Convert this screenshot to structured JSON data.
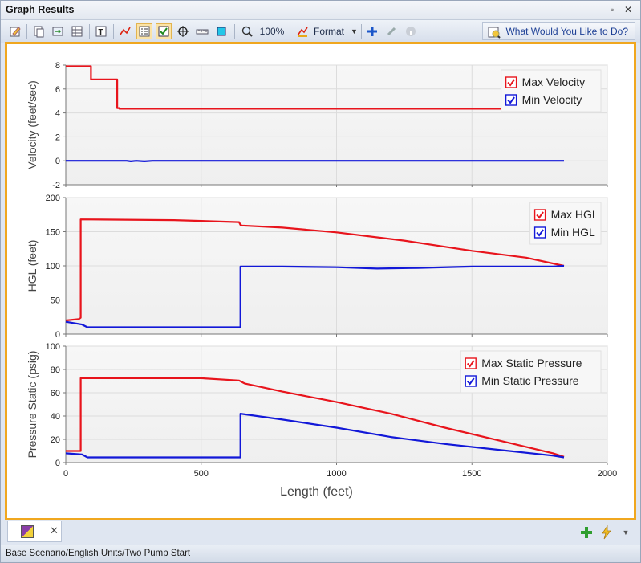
{
  "window": {
    "title": "Graph Results",
    "pin_glyph": "▫",
    "close_glyph": "✕"
  },
  "toolbar": {
    "zoom_label": "100%",
    "format_label": "Format",
    "what_label": "What Would You Like to Do?",
    "icons": [
      "edit-icon",
      "copy-icon",
      "export-icon",
      "table-icon",
      "text-icon",
      "line-style-icon",
      "legend-icon",
      "checkbox-icon",
      "crosshair-icon",
      "ruler-icon",
      "box-icon",
      "zoom-icon",
      "format-icon",
      "add-icon",
      "pin-icon",
      "info-icon",
      "help-icon"
    ]
  },
  "tab": {
    "close_glyph": "✕"
  },
  "status": {
    "text": "Base Scenario/English Units/Two Pump Start"
  },
  "colors": {
    "max_series": "#e8141c",
    "min_series": "#1218d8",
    "frame_accent": "#f0a71f",
    "plot_bg": "#efefef"
  },
  "chart_data": [
    {
      "type": "line",
      "ylabel": "Velocity (feet/sec)",
      "xlim": [
        0,
        2000
      ],
      "ylim": [
        -2,
        8
      ],
      "yticks": [
        "-2",
        "0",
        "2",
        "4",
        "6",
        "8"
      ],
      "ytick_values": [
        -2,
        0,
        2,
        4,
        6,
        8
      ],
      "grid": true,
      "legend_position": "top-right",
      "series": [
        {
          "name": "Max Velocity",
          "color": "#e8141c",
          "x": [
            0,
            93,
            93,
            190,
            190,
            198,
            198,
            1840
          ],
          "y": [
            7.9,
            7.9,
            6.8,
            6.8,
            4.4,
            4.4,
            4.35,
            4.35
          ]
        },
        {
          "name": "Min Velocity",
          "color": "#1218d8",
          "x": [
            0,
            225,
            240,
            260,
            290,
            320,
            1840
          ],
          "y": [
            0,
            0,
            -0.05,
            0,
            -0.05,
            0,
            0
          ]
        }
      ]
    },
    {
      "type": "line",
      "ylabel": "HGL (feet)",
      "xlim": [
        0,
        2000
      ],
      "ylim": [
        0,
        200
      ],
      "yticks": [
        "0",
        "50",
        "100",
        "150",
        "200"
      ],
      "ytick_values": [
        0,
        50,
        100,
        150,
        200
      ],
      "grid": true,
      "legend_position": "top-right",
      "series": [
        {
          "name": "Max HGL",
          "color": "#e8141c",
          "x": [
            0,
            48,
            55,
            55,
            400,
            640,
            645,
            650,
            800,
            1000,
            1250,
            1500,
            1700,
            1840
          ],
          "y": [
            20,
            22,
            24,
            168,
            167,
            164,
            160,
            159,
            156,
            149,
            137,
            122,
            112,
            100
          ]
        },
        {
          "name": "Min HGL",
          "color": "#1218d8",
          "x": [
            0,
            60,
            80,
            640,
            645,
            645,
            800,
            1000,
            1150,
            1300,
            1500,
            1800,
            1840
          ],
          "y": [
            18,
            14,
            10,
            10,
            10,
            99,
            99,
            98,
            96,
            97,
            99,
            99,
            100
          ]
        }
      ]
    },
    {
      "type": "line",
      "ylabel": "Pressure Static (psig)",
      "xlabel": "Length (feet)",
      "xlim": [
        0,
        2000
      ],
      "ylim": [
        0,
        100
      ],
      "xticks": [
        "0",
        "500",
        "1000",
        "1500",
        "2000"
      ],
      "xtick_values": [
        0,
        500,
        1000,
        1500,
        2000
      ],
      "yticks": [
        "0",
        "20",
        "40",
        "60",
        "80",
        "100"
      ],
      "ytick_values": [
        0,
        20,
        40,
        60,
        80,
        100
      ],
      "grid": true,
      "legend_position": "top-right",
      "series": [
        {
          "name": "Max Static Pressure",
          "color": "#e8141c",
          "x": [
            0,
            50,
            55,
            55,
            500,
            640,
            660,
            800,
            1000,
            1200,
            1400,
            1600,
            1800,
            1840
          ],
          "y": [
            10,
            10,
            10,
            72.5,
            72.5,
            70.5,
            68,
            61,
            52,
            42,
            30,
            19,
            8,
            5
          ]
        },
        {
          "name": "Min Static Pressure",
          "color": "#1218d8",
          "x": [
            0,
            60,
            80,
            640,
            645,
            645,
            800,
            1000,
            1200,
            1400,
            1600,
            1800,
            1840
          ],
          "y": [
            8,
            7,
            4.5,
            4.5,
            4.5,
            42,
            37,
            30,
            22,
            16,
            11,
            6,
            4.5
          ]
        }
      ]
    }
  ]
}
